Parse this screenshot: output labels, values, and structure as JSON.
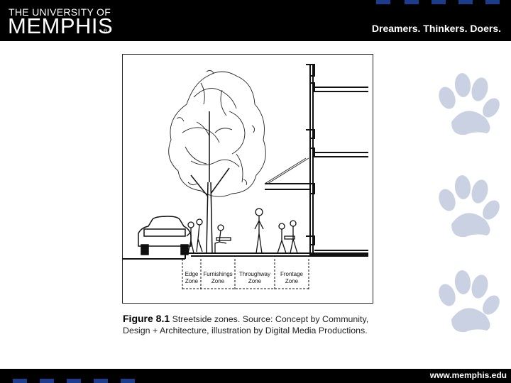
{
  "header": {
    "logo_top": "THE UNIVERSITY OF",
    "logo_main": "MEMPHIS",
    "logo_tm": "®",
    "tagline": "Dreamers. Thinkers. Doers."
  },
  "figure": {
    "zones": [
      {
        "line1": "Edge",
        "line2": "Zone"
      },
      {
        "line1": "Furnishings",
        "line2": "Zone"
      },
      {
        "line1": "Throughway",
        "line2": "Zone"
      },
      {
        "line1": "Frontage",
        "line2": "Zone"
      }
    ]
  },
  "caption": {
    "label": "Figure 8.1",
    "text": " Streetside zones. Source: Concept by Community, Design + Architecture, illustration by Digital Media Productions."
  },
  "footer": {
    "url": "www.memphis.edu"
  },
  "colors": {
    "brand_blue": "#1d3d8c",
    "paw": "#c9d1e3",
    "header_bg": "#000000"
  },
  "icons": [
    "paw-icon",
    "paw-icon",
    "paw-icon"
  ]
}
